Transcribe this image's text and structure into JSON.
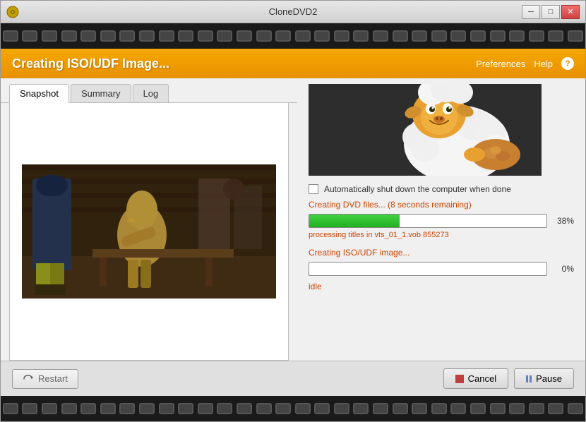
{
  "window": {
    "title": "CloneDVD2",
    "icon": "dvd-icon"
  },
  "title_bar": {
    "controls": {
      "minimize": "─",
      "maximize": "□",
      "close": "✕"
    }
  },
  "filmstrip": {
    "hole_count": 30
  },
  "header": {
    "title": "Creating ISO/UDF Image...",
    "preferences_label": "Preferences",
    "help_label": "Help",
    "help_icon": "?"
  },
  "tabs": [
    {
      "id": "snapshot",
      "label": "Snapshot",
      "active": true
    },
    {
      "id": "summary",
      "label": "Summary",
      "active": false
    },
    {
      "id": "log",
      "label": "Log",
      "active": false
    }
  ],
  "progress": {
    "checkbox_label": "Automatically shut down the computer when done",
    "step1_label": "Creating DVD files... (8 seconds remaining)",
    "step1_pct": "38%",
    "step1_fill_width": "38%",
    "step1_subtitle": "processing titles in vts_01_1.vob 855273",
    "step2_label": "Creating ISO/UDF image...",
    "step2_pct": "0%",
    "step2_fill_width": "0%",
    "status": "idle"
  },
  "footer": {
    "restart_label": "Restart",
    "cancel_label": "Cancel",
    "pause_label": "Pause"
  }
}
